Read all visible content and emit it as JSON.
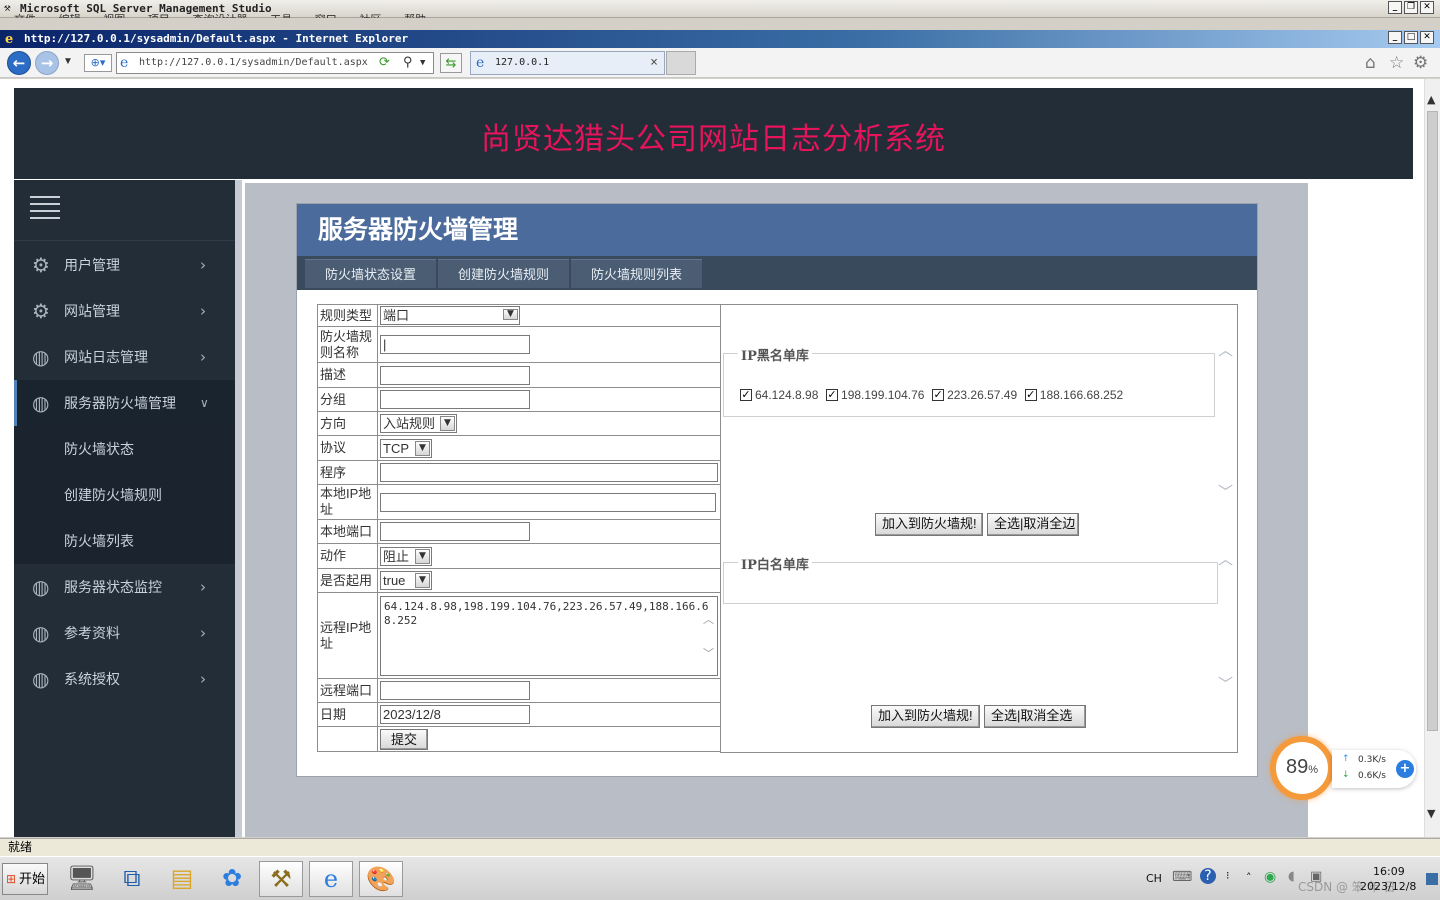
{
  "ssms": {
    "title": "Microsoft SQL Server Management Studio",
    "menu_ghost": "文件 编辑 视图 项目 查询设计器 工具 窗口 社区 帮助"
  },
  "ie": {
    "title": "http://127.0.0.1/sysadmin/Default.aspx - Internet Explorer",
    "address": "http://127.0.0.1/sysadmin/Default.aspx",
    "tab_label": "127.0.0.1",
    "tab_close": "×",
    "icons": [
      "back-icon",
      "forward-icon",
      "home-icon",
      "favorites-star-icon",
      "tools-gear-icon",
      "refresh-icon",
      "search-icon"
    ]
  },
  "site": {
    "title": "尚贤达猎头公司网站日志分析系统"
  },
  "sidebar": {
    "items": [
      {
        "label": "用户管理",
        "icon": "gear-icon"
      },
      {
        "label": "网站管理",
        "icon": "gear-icon"
      },
      {
        "label": "网站日志管理",
        "icon": "globe-icon"
      },
      {
        "label": "服务器防火墙管理",
        "icon": "globe-icon"
      },
      {
        "label": "服务器状态监控",
        "icon": "globe-icon"
      },
      {
        "label": "参考资料",
        "icon": "globe-icon"
      },
      {
        "label": "系统授权",
        "icon": "globe-icon"
      }
    ],
    "subitems": [
      "防火墙状态",
      "创建防火墙规则",
      "防火墙列表"
    ]
  },
  "panel": {
    "title": "服务器防火墙管理",
    "tabs": [
      "防火墙状态设置",
      "创建防火墙规则",
      "防火墙规则列表"
    ]
  },
  "form": {
    "labels": {
      "rule_type": "规则类型",
      "rule_name": "防火墙规则名称",
      "description": "描述",
      "group": "分组",
      "direction": "方向",
      "protocol": "协议",
      "program": "程序",
      "local_ip": "本地IP地址",
      "local_port": "本地端口",
      "action": "动作",
      "enabled": "是否起用",
      "remote_ip": "远程IP地址",
      "remote_port": "远程端口",
      "date": "日期"
    },
    "values": {
      "rule_type": "端口",
      "direction": "入站规则",
      "protocol": "TCP",
      "action": "阻止",
      "enabled": "true",
      "remote_ip": "64.124.8.98,198.199.104.76,223.26.57.49,188.166.68.252",
      "date": "2023/12/8"
    },
    "submit": "提交"
  },
  "blacklist": {
    "legend": "IP黑名单库",
    "ips": [
      "64.124.8.98",
      "198.199.104.76",
      "223.26.57.49",
      "188.166.68.252"
    ],
    "add_button": "加入到防火墙规!",
    "toggle_button": "全选|取消全边"
  },
  "whitelist": {
    "legend": "IP白名单库",
    "add_button": "加入到防火墙规!",
    "toggle_button": "全选|取消全选"
  },
  "status": {
    "text": "就绪"
  },
  "taskbar": {
    "start": "开始",
    "lang": "CH",
    "time": "16:09",
    "date": "2023/12/8",
    "watermark": "CSDN @ 笨 年 日"
  },
  "speed": {
    "percent": "89",
    "percent_unit": "%",
    "up": "0.3K/s",
    "down": "0.6K/s"
  },
  "colors": {
    "header_bg": "#222d38",
    "site_title": "#e6145a",
    "panel_head": "#4a6b9b",
    "accent_ring": "#f59a3b"
  }
}
